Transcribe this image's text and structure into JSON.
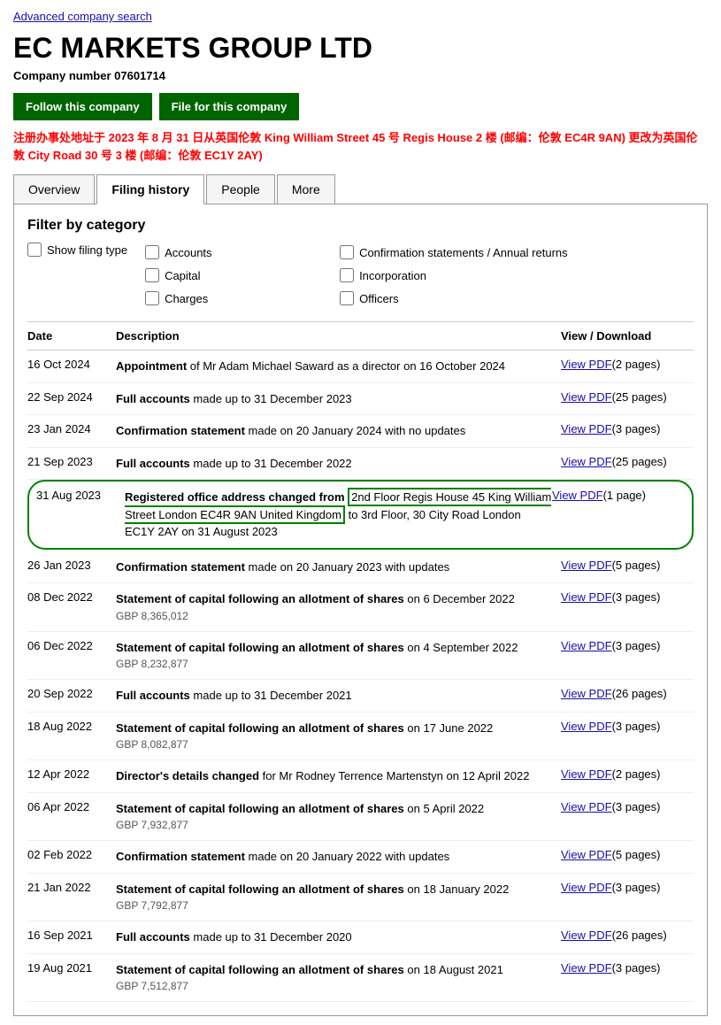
{
  "page": {
    "advanced_search_label": "Advanced company search",
    "company_title": "EC MARKETS GROUP LTD",
    "company_number_label": "Company number",
    "company_number": "07601714",
    "btn_follow": "Follow this company",
    "btn_file": "File for this company",
    "address_notice": "注册办事处地址于 2023 年 8 月 31 日从英国伦敦 King William Street 45 号 Regis House 2 楼 (邮编：伦敦 EC4R 9AN) 更改为英国伦敦 City Road 30 号 3 楼 (邮编：伦敦 EC1Y 2AY)",
    "tabs": [
      {
        "label": "Overview",
        "active": false
      },
      {
        "label": "Filing history",
        "active": true
      },
      {
        "label": "People",
        "active": false
      },
      {
        "label": "More",
        "active": false
      }
    ],
    "filter": {
      "title": "Filter by category",
      "show_filing_label": "Show filing type",
      "categories": [
        "Accounts",
        "Capital",
        "Charges",
        "Confirmation statements / Annual returns",
        "Incorporation",
        "Officers"
      ]
    },
    "table_headers": {
      "date": "Date",
      "description": "Description",
      "view": "View / Download"
    },
    "filings": [
      {
        "date": "16 Oct 2024",
        "description_bold": "Appointment",
        "description_rest": " of Mr Adam Michael Saward as a director on 16 October 2024",
        "sub": "",
        "view_text": "View PDF",
        "view_pages": "(2 pages)",
        "highlighted": false
      },
      {
        "date": "22 Sep 2024",
        "description_bold": "Full accounts",
        "description_rest": " made up to 31 December 2023",
        "sub": "",
        "view_text": "View PDF",
        "view_pages": "(25 pages)",
        "highlighted": false
      },
      {
        "date": "23 Jan 2024",
        "description_bold": "Confirmation statement",
        "description_rest": " made on 20 January 2024 with no updates",
        "sub": "",
        "view_text": "View PDF",
        "view_pages": "(3 pages)",
        "highlighted": false
      },
      {
        "date": "21 Sep 2023",
        "description_bold": "Full accounts",
        "description_rest": " made up to 31 December 2022",
        "sub": "",
        "view_text": "View PDF",
        "view_pages": "(25 pages)",
        "highlighted": false
      },
      {
        "date": "31 Aug 2023",
        "description_bold": "Registered office address changed from",
        "description_green": " 2nd Floor Regis House 45 King William Street London EC4R 9AN United Kingdom",
        "description_rest": " to 3rd Floor, 30 City Road London EC1Y 2AY on 31 August 2023",
        "sub": "",
        "view_text": "View PDF",
        "view_pages": "(1 page)",
        "highlighted": true
      },
      {
        "date": "26 Jan 2023",
        "description_bold": "Confirmation statement",
        "description_rest": " made on 20 January 2023 with updates",
        "sub": "",
        "view_text": "View PDF",
        "view_pages": "(5 pages)",
        "highlighted": false
      },
      {
        "date": "08 Dec 2022",
        "description_bold": "Statement of capital following an allotment of shares",
        "description_rest": " on 6 December 2022",
        "sub": "GBP 8,365,012",
        "view_text": "View PDF",
        "view_pages": "(3 pages)",
        "highlighted": false
      },
      {
        "date": "06 Dec 2022",
        "description_bold": "Statement of capital following an allotment of shares",
        "description_rest": " on 4 September 2022",
        "sub": "GBP 8,232,877",
        "view_text": "View PDF",
        "view_pages": "(3 pages)",
        "highlighted": false
      },
      {
        "date": "20 Sep 2022",
        "description_bold": "Full accounts",
        "description_rest": " made up to 31 December 2021",
        "sub": "",
        "view_text": "View PDF",
        "view_pages": "(26 pages)",
        "highlighted": false
      },
      {
        "date": "18 Aug 2022",
        "description_bold": "Statement of capital following an allotment of shares",
        "description_rest": " on 17 June 2022",
        "sub": "GBP 8,082,877",
        "view_text": "View PDF",
        "view_pages": "(3 pages)",
        "highlighted": false
      },
      {
        "date": "12 Apr 2022",
        "description_bold": "Director's details changed",
        "description_rest": " for Mr Rodney Terrence Martenstyn on 12 April 2022",
        "sub": "",
        "view_text": "View PDF",
        "view_pages": "(2 pages)",
        "highlighted": false
      },
      {
        "date": "06 Apr 2022",
        "description_bold": "Statement of capital following an allotment of shares",
        "description_rest": " on 5 April 2022",
        "sub": "GBP 7,932,877",
        "view_text": "View PDF",
        "view_pages": "(3 pages)",
        "highlighted": false
      },
      {
        "date": "02 Feb 2022",
        "description_bold": "Confirmation statement",
        "description_rest": " made on 20 January 2022 with updates",
        "sub": "",
        "view_text": "View PDF",
        "view_pages": "(5 pages)",
        "highlighted": false
      },
      {
        "date": "21 Jan 2022",
        "description_bold": "Statement of capital following an allotment of shares",
        "description_rest": " on 18 January 2022",
        "sub": "GBP 7,792,877",
        "view_text": "View PDF",
        "view_pages": "(3 pages)",
        "highlighted": false
      },
      {
        "date": "16 Sep 2021",
        "description_bold": "Full accounts",
        "description_rest": " made up to 31 December 2020",
        "sub": "",
        "view_text": "View PDF",
        "view_pages": "(26 pages)",
        "highlighted": false
      },
      {
        "date": "19 Aug 2021",
        "description_bold": "Statement of capital following an allotment of shares",
        "description_rest": " on 18 August 2021",
        "sub": "GBP 7,512,877",
        "view_text": "View PDF",
        "view_pages": "(3 pages)",
        "highlighted": false
      }
    ]
  }
}
